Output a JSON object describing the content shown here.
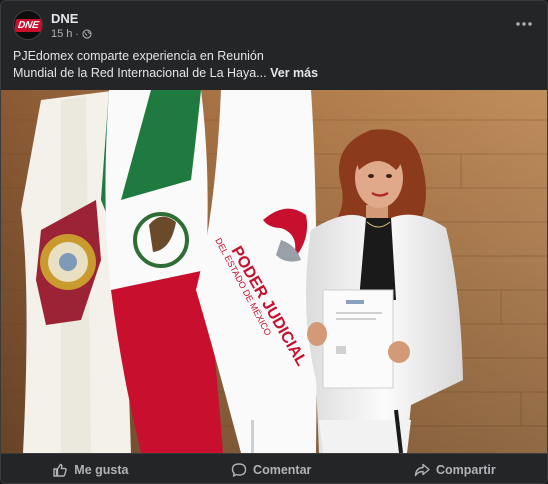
{
  "post": {
    "page_name": "DNE",
    "avatar_logo_text": "DNE",
    "time": "15 h",
    "audience_icon": "globe-icon",
    "menu_icon": "more-options-icon",
    "caption_line1": "PJEdomex comparte experiencia en Reunión",
    "caption_line2": "Mundial de la Red Internacional de La Haya...",
    "see_more": "Ver más",
    "photo_banner_text_1": "PODER JUDICIAL",
    "photo_banner_text_2": "DEL ESTADO DE MÉXICO"
  },
  "actions": [
    {
      "label": "Me gusta",
      "icon": "like-thumb-icon"
    },
    {
      "label": "Comentar",
      "icon": "comment-bubble-icon"
    },
    {
      "label": "Compartir",
      "icon": "share-arrow-icon"
    }
  ],
  "colors": {
    "card_bg": "#242526",
    "text_primary": "#e4e6eb",
    "text_secondary": "#b0b3b8",
    "brand_red": "#c8102e"
  }
}
